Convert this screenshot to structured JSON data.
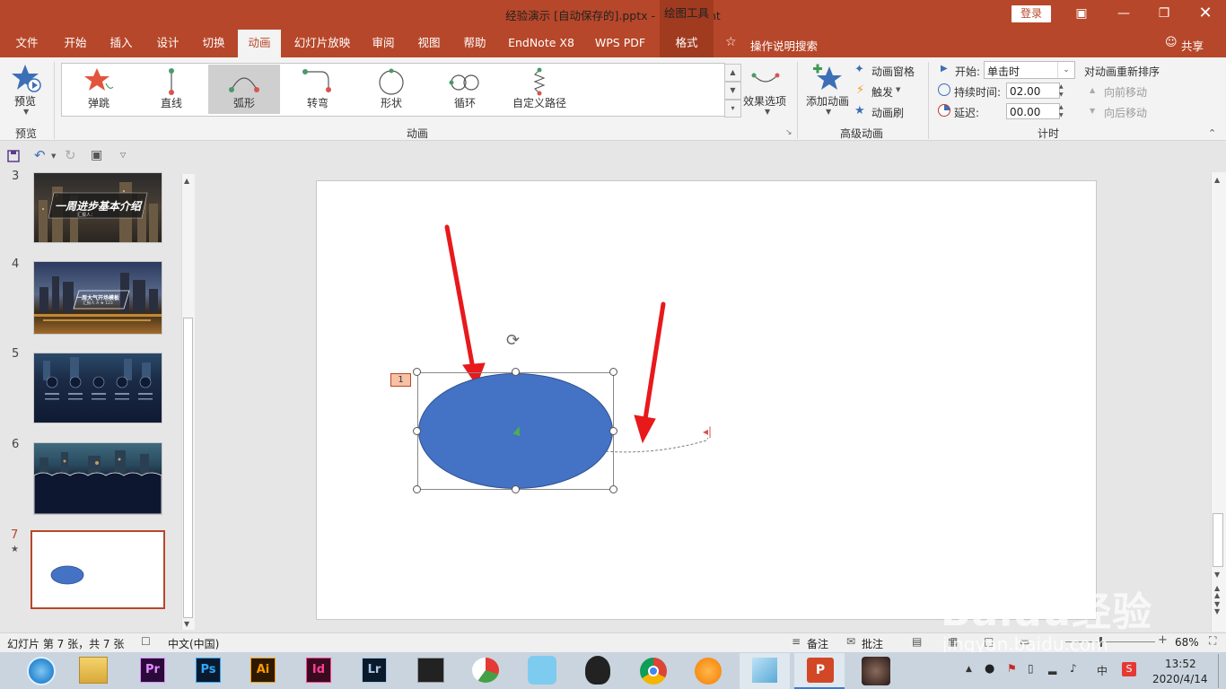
{
  "window": {
    "title": "经验演示 [自动保存的].pptx  -  PowerPoint",
    "context_tab": "绘图工具",
    "login_label": "登录"
  },
  "tabs": [
    "文件",
    "开始",
    "插入",
    "设计",
    "切换",
    "动画",
    "幻灯片放映",
    "审阅",
    "视图",
    "帮助",
    "EndNote X8",
    "WPS PDF",
    "格式"
  ],
  "search_label": "操作说明搜索",
  "share_label": "共享",
  "ribbon": {
    "preview": {
      "button": "预览",
      "group": "预览"
    },
    "animation_gallery": [
      "弹跳",
      "直线",
      "弧形",
      "转弯",
      "形状",
      "循环",
      "自定义路径"
    ],
    "selected_animation": "弧形",
    "effect_options": "效果选项",
    "animation_group": "动画",
    "advanced": {
      "add_animation": "添加动画",
      "animation_pane": "动画窗格",
      "trigger": "触发",
      "animation_painter": "动画刷",
      "group": "高级动画"
    },
    "timing": {
      "start_label": "开始:",
      "start_value": "单击时",
      "duration_label": "持续时间:",
      "duration_value": "02.00",
      "delay_label": "延迟:",
      "delay_value": "00.00",
      "reorder_title": "对动画重新排序",
      "move_earlier": "向前移动",
      "move_later": "向后移动",
      "group": "计时"
    }
  },
  "slides": [
    {
      "number": "3",
      "title": "一周进步基本介绍",
      "subtitle": "汇报人："
    },
    {
      "number": "4",
      "title": "一周大气开场模板",
      "subtitle": "汇报人 A ★ 123"
    },
    {
      "number": "5"
    },
    {
      "number": "6"
    },
    {
      "number": "7",
      "star": "★"
    }
  ],
  "canvas": {
    "animation_badge": "1",
    "shape_color": "#4472c4",
    "arrow_color": "#e8191b"
  },
  "status": {
    "slide_info": "幻灯片 第 7 张，共 7 张",
    "language": "中文(中国)",
    "notes": "备注",
    "comments": "批注",
    "zoom": "68%"
  },
  "taskbar": {
    "apps": [
      "Pr",
      "Ps",
      "Ai",
      "Id",
      "Lr"
    ],
    "time": "13:52",
    "date": "2020/4/14",
    "ime": "中"
  },
  "watermark": {
    "brand": "Baidu经验",
    "url": "jingyan.baidu.com"
  }
}
